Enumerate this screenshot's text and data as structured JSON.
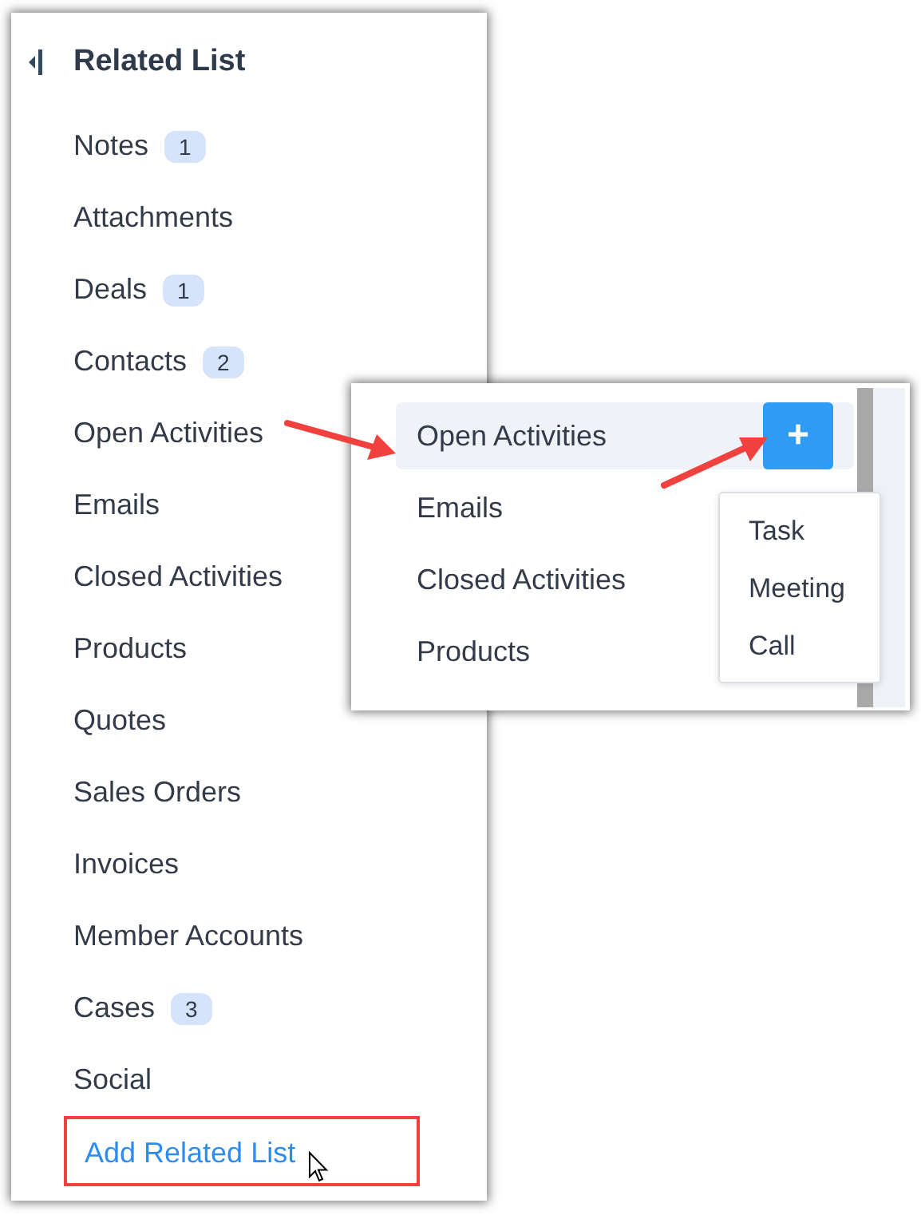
{
  "panel": {
    "title": "Related List",
    "items": [
      {
        "label": "Notes",
        "count": "1"
      },
      {
        "label": "Attachments"
      },
      {
        "label": "Deals",
        "count": "1"
      },
      {
        "label": "Contacts",
        "count": "2"
      },
      {
        "label": "Open Activities"
      },
      {
        "label": "Emails"
      },
      {
        "label": "Closed Activities"
      },
      {
        "label": "Products"
      },
      {
        "label": "Quotes"
      },
      {
        "label": "Sales Orders"
      },
      {
        "label": "Invoices"
      },
      {
        "label": "Member Accounts"
      },
      {
        "label": "Cases",
        "count": "3"
      },
      {
        "label": "Social"
      }
    ],
    "add_link": "Add Related List"
  },
  "zoom_callout": {
    "items": [
      {
        "label": "Open Activities",
        "selected": true
      },
      {
        "label": "Emails",
        "selected": false
      },
      {
        "label": "Closed Activities",
        "selected": false
      },
      {
        "label": "Products",
        "selected": false
      }
    ],
    "add_button": "+",
    "menu": [
      "Task",
      "Meeting",
      "Call"
    ]
  }
}
